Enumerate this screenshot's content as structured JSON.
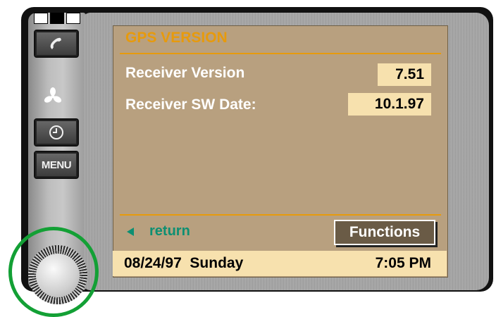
{
  "screen": {
    "title": "GPS VERSION",
    "rows": [
      {
        "label": "Receiver Version",
        "value": "7.51"
      },
      {
        "label": "Receiver SW Date:",
        "value": "10.1.97"
      }
    ],
    "return_label": "return",
    "functions_label": "Functions",
    "status": {
      "date": "08/24/97  Sunday",
      "time": "7:05 PM"
    }
  },
  "hardware": {
    "menu_label": "MENU",
    "icons": [
      "phone-icon",
      "fan-icon",
      "clock-icon",
      "volume-knob"
    ]
  },
  "colors": {
    "screen_bg": "#b8a07f",
    "title": "#e79a0c",
    "value_bg": "#f7e1ae",
    "return_text": "#0d8f72",
    "highlight_ring": "#13a035"
  }
}
